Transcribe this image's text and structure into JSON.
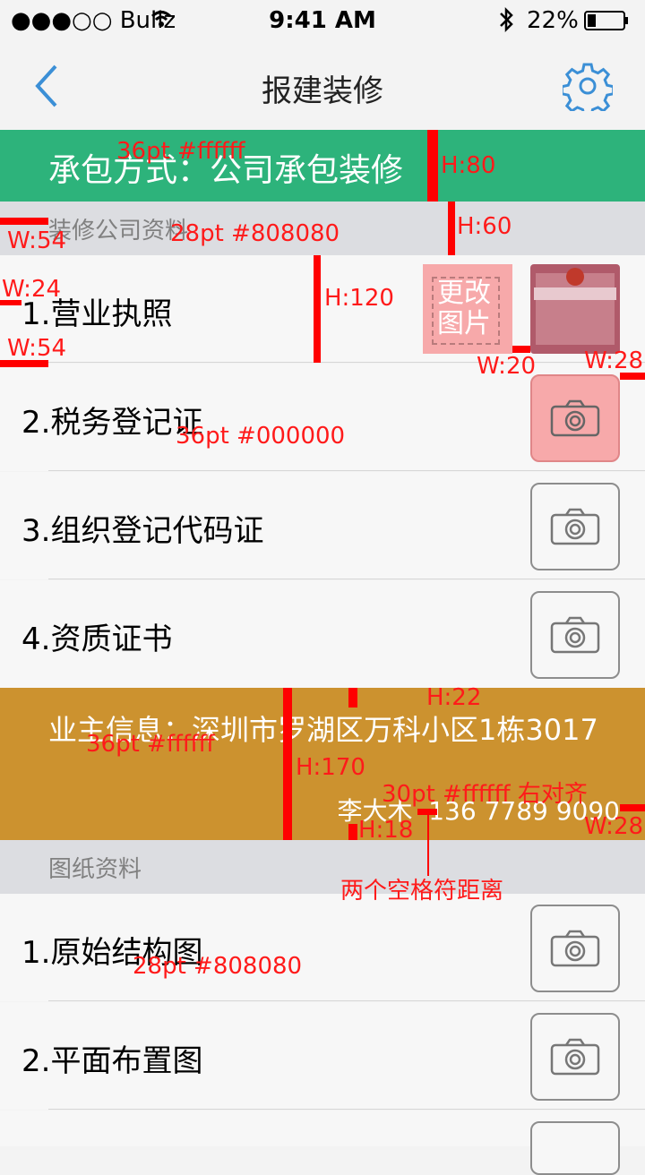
{
  "status_bar": {
    "carrier": "●●●○○ Bullz",
    "time": "9:41 AM",
    "battery": "22%"
  },
  "nav": {
    "title": "报建装修"
  },
  "contract": {
    "text": "承包方式：公司承包装修"
  },
  "section_company": {
    "title": "装修公司资料"
  },
  "company_docs": [
    {
      "label": "1.营业执照",
      "change_label": "更改图片"
    },
    {
      "label": "2.税务登记证"
    },
    {
      "label": "3.组织登记代码证"
    },
    {
      "label": "4.资质证书"
    }
  ],
  "owner": {
    "address": "业主信息：深圳市罗湖区万科小区1栋3017",
    "contact": "李大木  136 7789 9090"
  },
  "section_drawings": {
    "title": "图纸资料"
  },
  "drawing_docs": [
    {
      "label": "1.原始结构图"
    },
    {
      "label": "2.平面布置图"
    }
  ],
  "annotations": {
    "a1": "36pt #ffffff",
    "a2": "H:80",
    "a3": "W:54",
    "a4": "28pt #808080",
    "a5": "H:60",
    "a6": "W:24",
    "a7": "H:120",
    "a8": "W:54",
    "a9": "W:20",
    "a10": "W:28",
    "a11": "36pt #000000",
    "a12": "H:22",
    "a13": "36pt #ffffff",
    "a14": "H:170",
    "a15": "30pt #ffffff 右对齐",
    "a16": "W:28",
    "a17": "H:18",
    "a18": "两个空格符距离",
    "a19": "28pt #808080"
  },
  "colors": {
    "green": "#2db37b",
    "owner": "#cc922f",
    "accent": "#3b8fd6",
    "annotation": "#ff0000"
  }
}
